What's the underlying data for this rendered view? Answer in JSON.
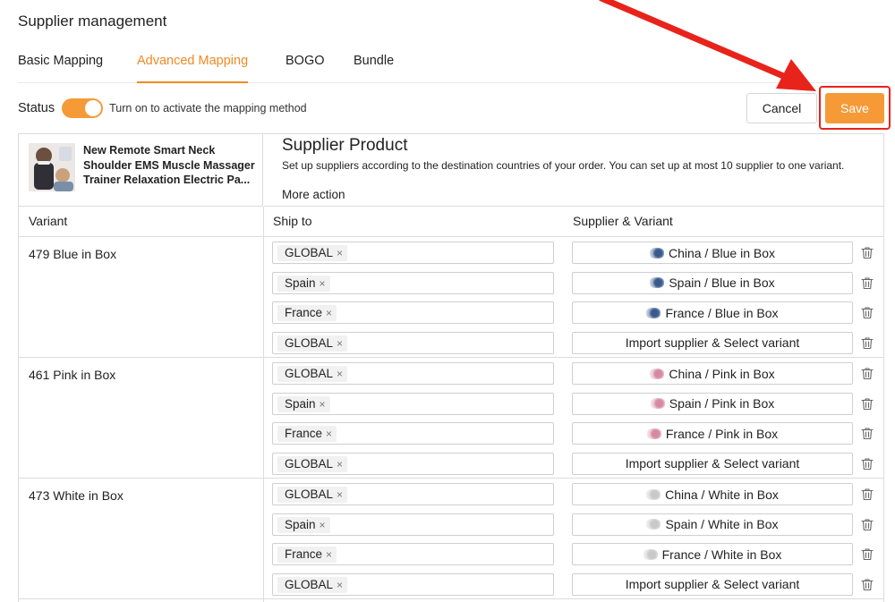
{
  "page": {
    "title": "Supplier management"
  },
  "tabs": [
    {
      "label": "Basic Mapping",
      "active": false
    },
    {
      "label": "Advanced Mapping",
      "active": true
    },
    {
      "label": "BOGO",
      "active": false
    },
    {
      "label": "Bundle",
      "active": false
    }
  ],
  "status": {
    "label": "Status",
    "enabled": true,
    "hint": "Turn on to activate the mapping method"
  },
  "actions": {
    "cancel_label": "Cancel",
    "save_label": "Save"
  },
  "product": {
    "name": "New Remote Smart Neck Shoulder EMS Muscle Massager Trainer Relaxation Electric Pa..."
  },
  "supplier_product": {
    "title": "Supplier Product",
    "description": "Set up suppliers according to the destination countries of your order. You can set up at most 10 supplier to one variant.",
    "more_action": "More action"
  },
  "columns": {
    "variant": "Variant",
    "ship_to": "Ship to",
    "supplier_variant": "Supplier & Variant"
  },
  "variants": [
    {
      "name": "479 Blue in Box",
      "rows": [
        {
          "ship_to": "GLOBAL",
          "supplier": "China / Blue in Box",
          "thumb": "blue"
        },
        {
          "ship_to": "Spain",
          "supplier": "Spain / Blue in Box",
          "thumb": "blue"
        },
        {
          "ship_to": "France",
          "supplier": "France / Blue in Box",
          "thumb": "blue"
        },
        {
          "ship_to": "GLOBAL",
          "supplier": "Import supplier & Select variant",
          "thumb": ""
        }
      ]
    },
    {
      "name": "461 Pink in Box",
      "rows": [
        {
          "ship_to": "GLOBAL",
          "supplier": "China / Pink in Box",
          "thumb": "pink"
        },
        {
          "ship_to": "Spain",
          "supplier": "Spain / Pink in Box",
          "thumb": "pink"
        },
        {
          "ship_to": "France",
          "supplier": "France / Pink in Box",
          "thumb": "pink"
        },
        {
          "ship_to": "GLOBAL",
          "supplier": "Import supplier & Select variant",
          "thumb": ""
        }
      ]
    },
    {
      "name": "473 White in Box",
      "rows": [
        {
          "ship_to": "GLOBAL",
          "supplier": "China / White in Box",
          "thumb": "white"
        },
        {
          "ship_to": "Spain",
          "supplier": "Spain / White in Box",
          "thumb": "white"
        },
        {
          "ship_to": "France",
          "supplier": "France / White in Box",
          "thumb": "white"
        },
        {
          "ship_to": "GLOBAL",
          "supplier": "Import supplier & Select variant",
          "thumb": ""
        }
      ]
    }
  ],
  "icons": {
    "chip_remove": "close-icon",
    "row_delete": "trash-icon",
    "annotation": "red-arrow-icon"
  },
  "colors": {
    "accent": "#f08a24",
    "save_button": "#f59a37",
    "highlight": "#e8231b"
  }
}
